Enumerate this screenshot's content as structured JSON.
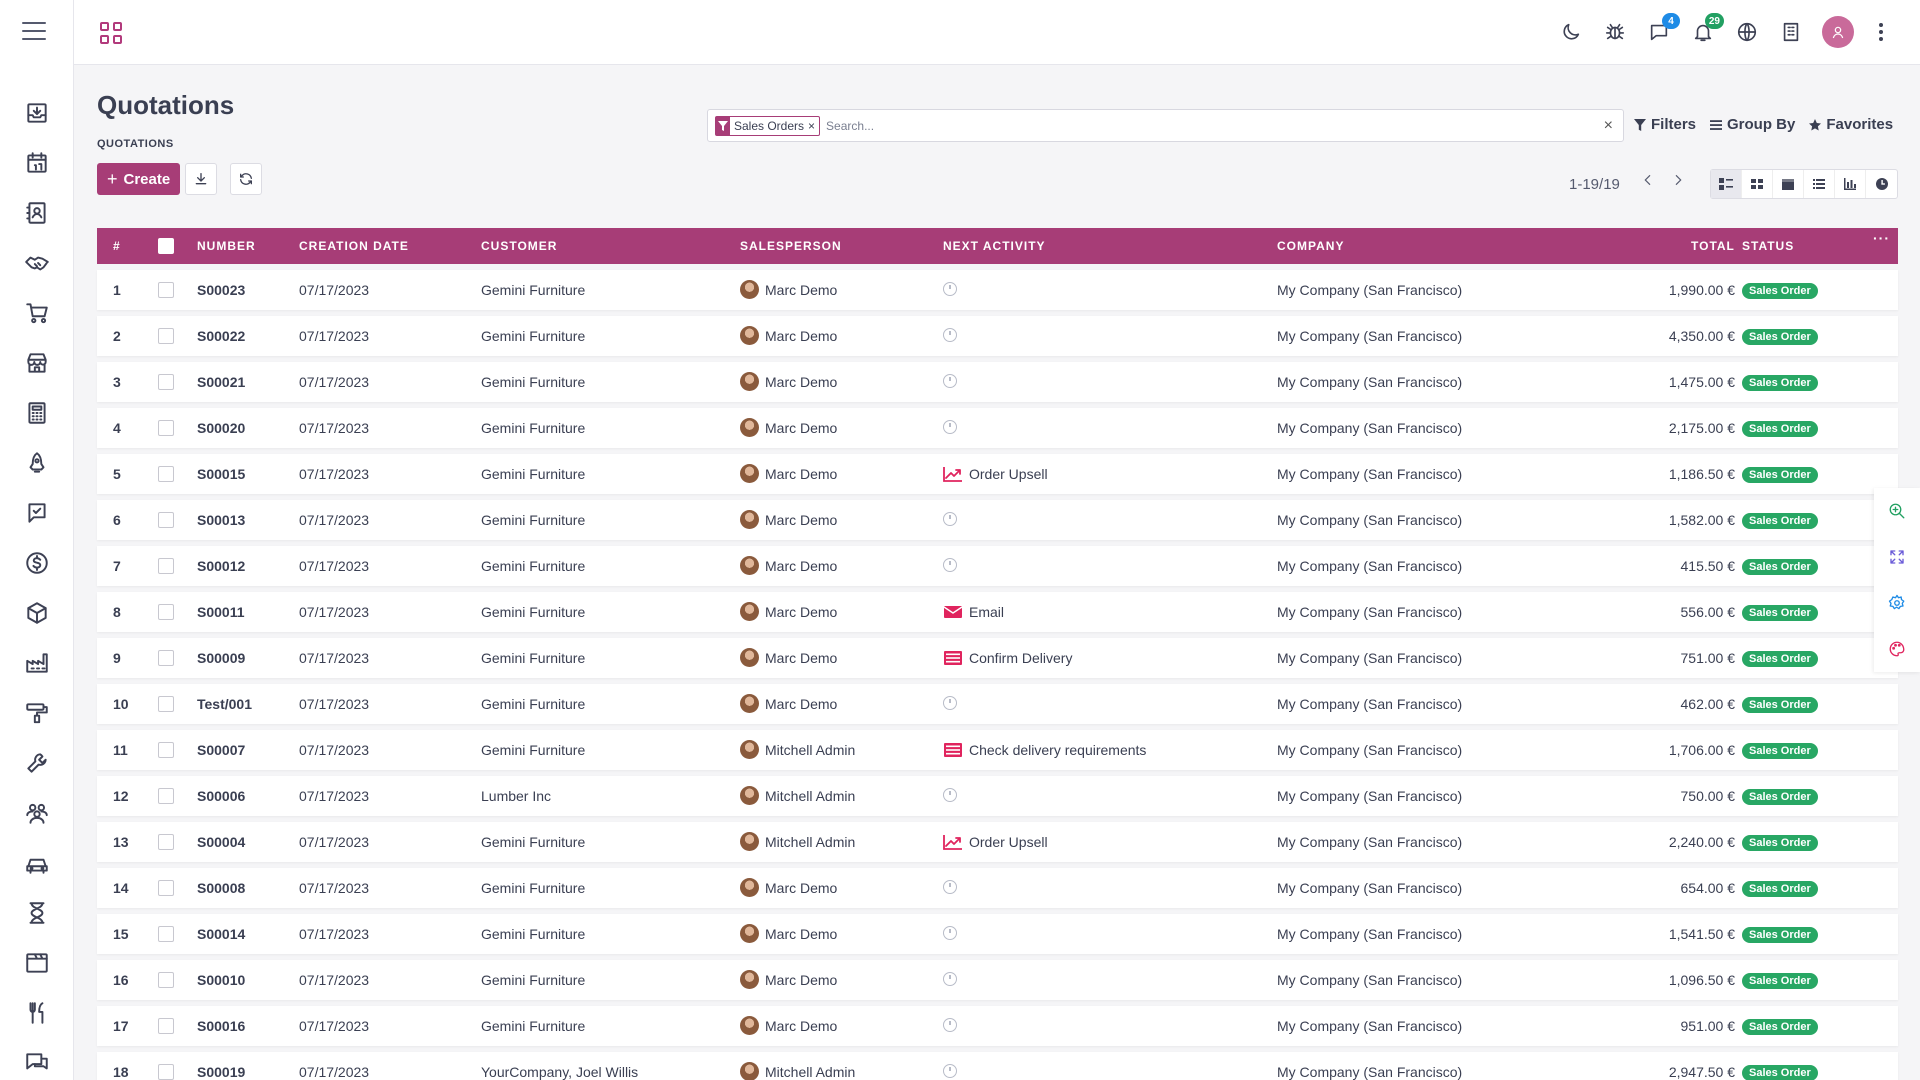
{
  "app": {
    "title": "Quotations",
    "breadcrumb": "QUOTATIONS"
  },
  "colors": {
    "brand": "#a73d77",
    "status_green": "#28a764",
    "activity_red": "#e0245e"
  },
  "sidebar_icons": [
    "inbox-download-icon",
    "calendar-icon",
    "contacts-icon",
    "handshake-icon",
    "cart-icon",
    "store-icon",
    "calculator-icon",
    "rocket-icon",
    "chat-check-icon",
    "dollar-icon",
    "box-icon",
    "factory-icon",
    "paint-roller-icon",
    "wrench-icon",
    "team-icon",
    "car-icon",
    "hourglass-icon",
    "browser-icon",
    "fork-knife-icon",
    "chat-bubbles-icon"
  ],
  "topbar": {
    "discuss_badge": "4",
    "notifications_badge": "29"
  },
  "toolbar": {
    "create_label": "Create"
  },
  "search": {
    "facet_label": "Sales Orders",
    "facet_remove": "×",
    "placeholder": "Search...",
    "clear": "×"
  },
  "filters": {
    "filters_label": "Filters",
    "group_by_label": "Group By",
    "favorites_label": "Favorites"
  },
  "pager": {
    "text": "1-19/19"
  },
  "table": {
    "columns": {
      "num": "#",
      "number": "NUMBER",
      "creation_date": "CREATION DATE",
      "customer": "CUSTOMER",
      "salesperson": "SALESPERSON",
      "next_activity": "NEXT ACTIVITY",
      "company": "COMPANY",
      "total": "TOTAL",
      "status": "STATUS"
    },
    "more": "···",
    "rows": [
      {
        "n": "1",
        "number": "S00023",
        "date": "07/17/2023",
        "customer": "Gemini Furniture",
        "salesperson": "Marc Demo",
        "activity": "",
        "activity_icon": "clock",
        "company": "My Company (San Francisco)",
        "total": "1,990.00 €",
        "status": "Sales Order"
      },
      {
        "n": "2",
        "number": "S00022",
        "date": "07/17/2023",
        "customer": "Gemini Furniture",
        "salesperson": "Marc Demo",
        "activity": "",
        "activity_icon": "clock",
        "company": "My Company (San Francisco)",
        "total": "4,350.00 €",
        "status": "Sales Order"
      },
      {
        "n": "3",
        "number": "S00021",
        "date": "07/17/2023",
        "customer": "Gemini Furniture",
        "salesperson": "Marc Demo",
        "activity": "",
        "activity_icon": "clock",
        "company": "My Company (San Francisco)",
        "total": "1,475.00 €",
        "status": "Sales Order"
      },
      {
        "n": "4",
        "number": "S00020",
        "date": "07/17/2023",
        "customer": "Gemini Furniture",
        "salesperson": "Marc Demo",
        "activity": "",
        "activity_icon": "clock",
        "company": "My Company (San Francisco)",
        "total": "2,175.00 €",
        "status": "Sales Order"
      },
      {
        "n": "5",
        "number": "S00015",
        "date": "07/17/2023",
        "customer": "Gemini Furniture",
        "salesperson": "Marc Demo",
        "activity": "Order Upsell",
        "activity_icon": "chart-up",
        "company": "My Company (San Francisco)",
        "total": "1,186.50 €",
        "status": "Sales Order"
      },
      {
        "n": "6",
        "number": "S00013",
        "date": "07/17/2023",
        "customer": "Gemini Furniture",
        "salesperson": "Marc Demo",
        "activity": "",
        "activity_icon": "clock",
        "company": "My Company (San Francisco)",
        "total": "1,582.00 €",
        "status": "Sales Order"
      },
      {
        "n": "7",
        "number": "S00012",
        "date": "07/17/2023",
        "customer": "Gemini Furniture",
        "salesperson": "Marc Demo",
        "activity": "",
        "activity_icon": "clock",
        "company": "My Company (San Francisco)",
        "total": "415.50 €",
        "status": "Sales Order"
      },
      {
        "n": "8",
        "number": "S00011",
        "date": "07/17/2023",
        "customer": "Gemini Furniture",
        "salesperson": "Marc Demo",
        "activity": "Email",
        "activity_icon": "envelope",
        "company": "My Company (San Francisco)",
        "total": "556.00 €",
        "status": "Sales Order"
      },
      {
        "n": "9",
        "number": "S00009",
        "date": "07/17/2023",
        "customer": "Gemini Furniture",
        "salesperson": "Marc Demo",
        "activity": "Confirm Delivery",
        "activity_icon": "tasks",
        "company": "My Company (San Francisco)",
        "total": "751.00 €",
        "status": "Sales Order"
      },
      {
        "n": "10",
        "number": "Test/001",
        "date": "07/17/2023",
        "customer": "Gemini Furniture",
        "salesperson": "Marc Demo",
        "activity": "",
        "activity_icon": "clock",
        "company": "My Company (San Francisco)",
        "total": "462.00 €",
        "status": "Sales Order"
      },
      {
        "n": "11",
        "number": "S00007",
        "date": "07/17/2023",
        "customer": "Gemini Furniture",
        "salesperson": "Mitchell Admin",
        "activity": "Check delivery requirements",
        "activity_icon": "tasks",
        "company": "My Company (San Francisco)",
        "total": "1,706.00 €",
        "status": "Sales Order"
      },
      {
        "n": "12",
        "number": "S00006",
        "date": "07/17/2023",
        "customer": "Lumber Inc",
        "salesperson": "Mitchell Admin",
        "activity": "",
        "activity_icon": "clock",
        "company": "My Company (San Francisco)",
        "total": "750.00 €",
        "status": "Sales Order"
      },
      {
        "n": "13",
        "number": "S00004",
        "date": "07/17/2023",
        "customer": "Gemini Furniture",
        "salesperson": "Mitchell Admin",
        "activity": "Order Upsell",
        "activity_icon": "chart-up",
        "company": "My Company (San Francisco)",
        "total": "2,240.00 €",
        "status": "Sales Order"
      },
      {
        "n": "14",
        "number": "S00008",
        "date": "07/17/2023",
        "customer": "Gemini Furniture",
        "salesperson": "Marc Demo",
        "activity": "",
        "activity_icon": "clock",
        "company": "My Company (San Francisco)",
        "total": "654.00 €",
        "status": "Sales Order"
      },
      {
        "n": "15",
        "number": "S00014",
        "date": "07/17/2023",
        "customer": "Gemini Furniture",
        "salesperson": "Marc Demo",
        "activity": "",
        "activity_icon": "clock",
        "company": "My Company (San Francisco)",
        "total": "1,541.50 €",
        "status": "Sales Order"
      },
      {
        "n": "16",
        "number": "S00010",
        "date": "07/17/2023",
        "customer": "Gemini Furniture",
        "salesperson": "Marc Demo",
        "activity": "",
        "activity_icon": "clock",
        "company": "My Company (San Francisco)",
        "total": "1,096.50 €",
        "status": "Sales Order"
      },
      {
        "n": "17",
        "number": "S00016",
        "date": "07/17/2023",
        "customer": "Gemini Furniture",
        "salesperson": "Marc Demo",
        "activity": "",
        "activity_icon": "clock",
        "company": "My Company (San Francisco)",
        "total": "951.00 €",
        "status": "Sales Order"
      },
      {
        "n": "18",
        "number": "S00019",
        "date": "07/17/2023",
        "customer": "YourCompany, Joel Willis",
        "salesperson": "Mitchell Admin",
        "activity": "",
        "activity_icon": "clock",
        "company": "My Company (San Francisco)",
        "total": "2,947.50 €",
        "status": "Sales Order"
      }
    ]
  },
  "floating_tools": [
    "zoom-icon",
    "expand-icon",
    "settings-icon",
    "palette-icon"
  ]
}
